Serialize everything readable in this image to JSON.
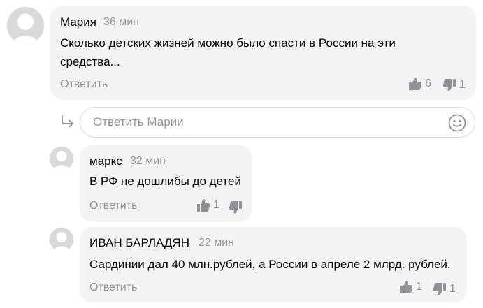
{
  "comments": [
    {
      "author": "Мария",
      "time": "36 мин",
      "text_lines": [
        "Сколько детских жизней можно было спасти в России на эти",
        "средства..."
      ],
      "reply_label": "Ответить",
      "likes": "6",
      "dislikes": "1"
    },
    {
      "author": "маркс",
      "time": "32 мин",
      "text_lines": [
        "В РФ не дошлибы до детей"
      ],
      "reply_label": "Ответить",
      "likes": "1",
      "dislikes": ""
    },
    {
      "author": "ИВАН БАРЛАДЯН",
      "time": "22 мин",
      "text_lines": [
        "Сардинии дал 40 млн.рублей, а России в апреле 2 млрд. рублей."
      ],
      "reply_label": "Ответить",
      "likes": "1",
      "dislikes": "1"
    }
  ],
  "reply_form": {
    "placeholder": "Ответить Марии",
    "arrow_icon": "reply-arrow-icon",
    "emoji_icon": "smile-icon"
  },
  "colors": {
    "bubble": "#f2f3f5",
    "muted": "#8f9399",
    "avatar": "#d9d9d9"
  }
}
